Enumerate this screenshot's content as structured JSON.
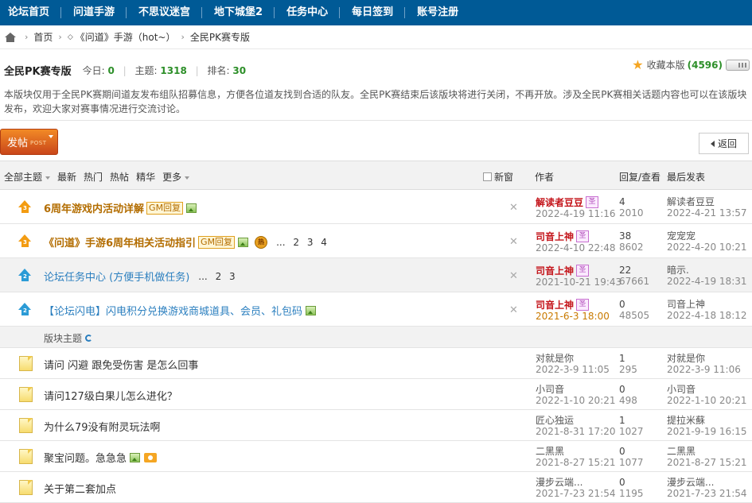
{
  "nav": {
    "items": [
      "论坛首页",
      "问道手游",
      "不思议迷宫",
      "地下城堡2",
      "任务中心",
      "每日签到",
      "账号注册"
    ]
  },
  "breadcrumb": {
    "home": "首页",
    "parent": "《问道》手游（hot~）",
    "current": "全民PK赛专版"
  },
  "forum": {
    "title": "全民PK赛专版",
    "today_label": "今日:",
    "today_value": "0",
    "topics_label": "主题:",
    "topics_value": "1318",
    "rank_label": "排名:",
    "rank_value": "30",
    "fav_label": "收藏本版",
    "fav_count": "(4596)",
    "description": "本版块仅用于全民PK赛期间道友发布组队招募信息，方便各位道友找到合适的队友。全民PK赛结束后该版块将进行关闭，不再开放。涉及全民PK赛相关话题内容也可以在该版块发布，欢迎大家对赛事情况进行交流讨论。"
  },
  "actions": {
    "post_label": "发帖",
    "post_sub": "POST",
    "back_label": "返回"
  },
  "table_header": {
    "filters": [
      "全部主题",
      "最新",
      "热门",
      "热帖",
      "精华",
      "更多"
    ],
    "new_window": "新窗",
    "author": "作者",
    "reply_view": "回复/查看",
    "last_post": "最后发表"
  },
  "sticky_threads": [
    {
      "title": "6周年游戏内活动详解",
      "tag": "GM回复",
      "author": "解读者豆豆",
      "date": "2022-4-19 11:16",
      "replies": "4",
      "views": "2010",
      "last_author": "解读者豆豆",
      "last_date": "2022-4-21 13:57"
    },
    {
      "title": "《问道》手游6周年相关活动指引",
      "tag": "GM回复",
      "pages": [
        "...",
        "2",
        "3",
        "4"
      ],
      "author": "司音上神",
      "date": "2022-4-10 22:48",
      "replies": "38",
      "views": "8602",
      "last_author": "宠宠宠",
      "last_date": "2022-4-20 10:21"
    },
    {
      "title": "论坛任务中心 (方便手机做任务)",
      "pages": [
        "...",
        "2",
        "3"
      ],
      "author": "司音上神",
      "date": "2021-10-21 19:43",
      "replies": "22",
      "views": "67661",
      "last_author": "暗示.",
      "last_date": "2022-4-19 18:31"
    },
    {
      "title": "【论坛闪电】闪电积分兑换游戏商城道具、会员、礼包码",
      "author": "司音上神",
      "date": "2021-6-3 18:00",
      "replies": "0",
      "views": "48505",
      "last_author": "司音上神",
      "last_date": "2022-4-18 18:12"
    }
  ],
  "section_label": "版块主题",
  "badge_text": "圣",
  "hot_text": "热",
  "threads": [
    {
      "title": "请问 闪避 跟免受伤害 是怎么回事",
      "author": "对就是你",
      "date": "2022-3-9 11:05",
      "replies": "1",
      "views": "295",
      "last_author": "对就是你",
      "last_date": "2022-3-9 11:06"
    },
    {
      "title": "请问127级白果儿怎么进化？",
      "author": "小司音",
      "date": "2022-1-10 20:21",
      "replies": "0",
      "views": "498",
      "last_author": "小司音",
      "last_date": "2022-1-10 20:21"
    },
    {
      "title": "为什么79没有附灵玩法啊",
      "author": "匠心独运",
      "date": "2021-8-31 17:20",
      "replies": "1",
      "views": "1027",
      "last_author": "提拉米蘇",
      "last_date": "2021-9-19 16:15"
    },
    {
      "title": "聚宝问题。急急急",
      "author": "二黑黑",
      "date": "2021-8-27 15:21",
      "replies": "0",
      "views": "1077",
      "last_author": "二黑黑",
      "last_date": "2021-8-27 15:21"
    },
    {
      "title": "关于第二套加点",
      "author": "漫步云端...",
      "date": "2021-7-23 21:54",
      "replies": "0",
      "views": "1195",
      "last_author": "漫步云端...",
      "last_date": "2021-7-23 21:54"
    }
  ]
}
